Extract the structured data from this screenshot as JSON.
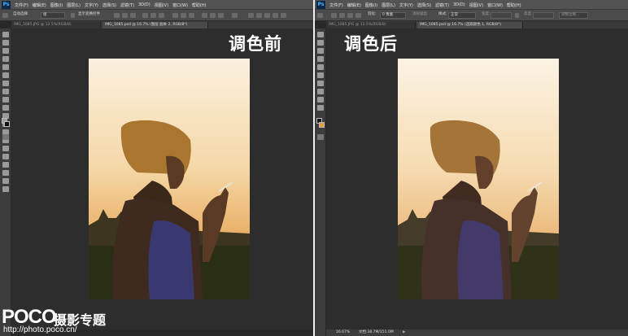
{
  "app": {
    "logo": "Ps"
  },
  "menu": [
    "文件(F)",
    "编辑(E)",
    "图像(I)",
    "图层(L)",
    "文字(Y)",
    "选择(S)",
    "滤镜(T)",
    "3D(D)",
    "视图(V)",
    "窗口(W)",
    "帮助(H)"
  ],
  "left": {
    "options": {
      "auto_select_label": "自动选择:",
      "auto_select_value": "组",
      "transform_label": "显示变换控件"
    },
    "tabs": [
      {
        "label": "IMG_1085.JPG @ 12.5%(RGB/8)",
        "active": false
      },
      {
        "label": "IMG_1085.psd @ 16.7% (图层 副本 2, RGB/8*)",
        "active": true
      }
    ],
    "caption": "调色前"
  },
  "right": {
    "options": {
      "feather_label": "羽化:",
      "feather_value": "0 像素",
      "antialias_label": "消除锯齿",
      "style_label": "样式:",
      "style_value": "正常",
      "width_label": "宽度:",
      "height_label": "高度:",
      "refine_label": "调整边缘..."
    },
    "tabs": [
      {
        "label": "IMG_1085.JPG @ 12.5%(RGB/8)",
        "active": false
      },
      {
        "label": "IMG_1085.psd @ 16.7% (选取颜色 1, RGB/8*)",
        "active": true
      }
    ],
    "caption": "调色后",
    "status": {
      "zoom": "16.67%",
      "doc": "文档:38.7M/151.0M"
    }
  },
  "watermark": {
    "logo": "POCO",
    "tag": "摄影专题",
    "url": "http://photo.poco.cn/"
  },
  "colors": {
    "foreground_right": "#1a1a1a",
    "background_right": "#e39a3c"
  }
}
